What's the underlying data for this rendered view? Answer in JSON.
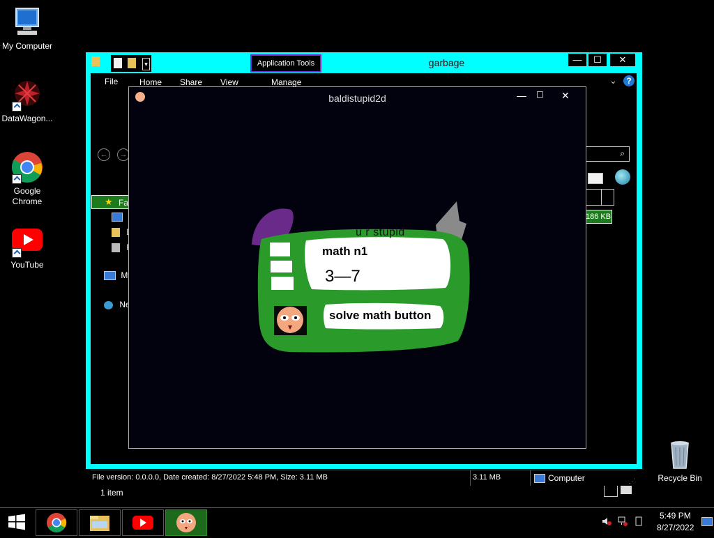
{
  "desktop": {
    "icons": [
      {
        "label": "My Computer",
        "icon": "computer-icon"
      },
      {
        "label": "DataWagon...",
        "icon": "datawagon-icon"
      },
      {
        "label": "Google Chrome",
        "icon": "chrome-icon"
      },
      {
        "label": "YouTube",
        "icon": "youtube-icon"
      },
      {
        "label": "Recycle Bin",
        "icon": "recycle-bin-icon"
      }
    ]
  },
  "explorer": {
    "title": "garbage",
    "context_tab": "Application Tools",
    "menu": [
      "File",
      "Home",
      "Share",
      "View",
      "Manage"
    ],
    "nav": {
      "favorites": "Fa",
      "my": "My",
      "network": "Ne",
      "d1": "D",
      "d2": "D",
      "f": "F"
    },
    "size_badge": "186 KB",
    "item_count": "1 item",
    "status": {
      "details": "File version: 0.0.0.0, Date created: 8/27/2022 5:48 PM, Size: 3.11 MB",
      "size": "3.11 MB",
      "location": "Computer"
    },
    "controls": {
      "minimize": "—",
      "maximize": "☐",
      "close": "✕"
    }
  },
  "game": {
    "title": "baldistupid2d",
    "taunt": "u r stupid",
    "problem_label": "math n1",
    "equation": "3—7",
    "solve_button": "solve math button",
    "controls": {
      "minimize": "—",
      "maximize": "☐",
      "close": "✕"
    }
  },
  "taskbar": {
    "clock_time": "5:49 PM",
    "clock_date": "8/27/2022",
    "apps": [
      "start-icon",
      "chrome-icon",
      "file-explorer-icon",
      "youtube-icon",
      "baldi-icon"
    ]
  },
  "colors": {
    "window_frame": "#00ffff",
    "game_green": "#2a9a2a",
    "purple_blob": "#6a2a8a"
  }
}
